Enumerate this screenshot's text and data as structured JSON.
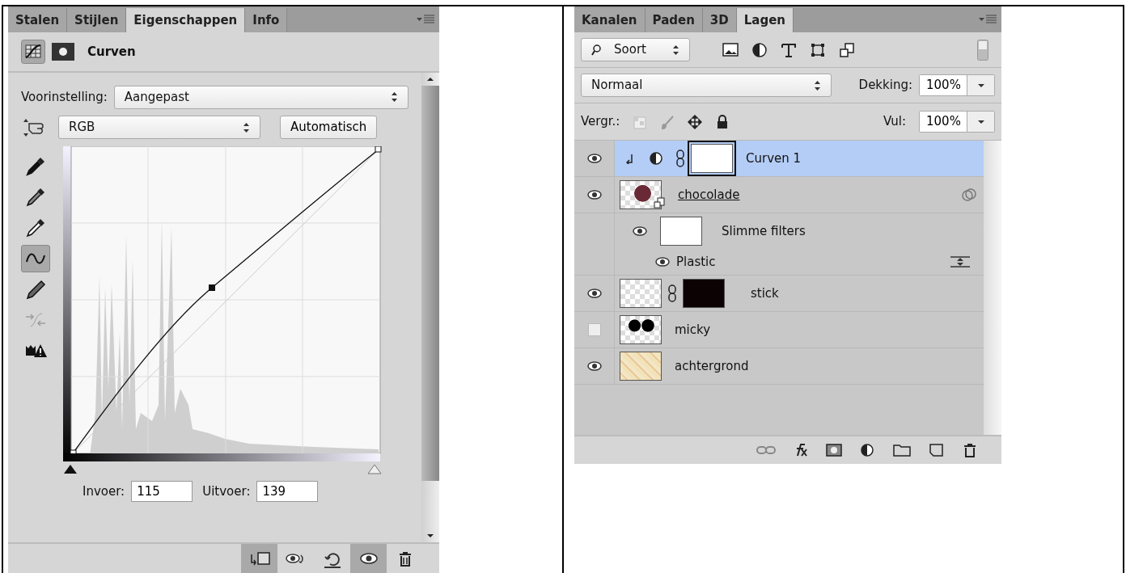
{
  "properties_panel": {
    "tabs": [
      {
        "label": "Stalen",
        "selected": false
      },
      {
        "label": "Stijlen",
        "selected": false
      },
      {
        "label": "Eigenschappen",
        "selected": true
      },
      {
        "label": "Info",
        "selected": false
      }
    ],
    "title": "Curven",
    "preset": {
      "label": "Voorinstelling:",
      "value": "Aangepast"
    },
    "channel": {
      "value": "RGB"
    },
    "auto_button": "Automatisch",
    "tools": [
      {
        "selected": false,
        "disabled": false
      },
      {
        "selected": false,
        "disabled": false
      },
      {
        "selected": false,
        "disabled": false
      },
      {
        "selected": true,
        "disabled": false
      },
      {
        "selected": false,
        "disabled": false
      },
      {
        "selected": false,
        "disabled": true
      },
      {
        "selected": false,
        "disabled": false
      }
    ],
    "input": {
      "label": "Invoer:",
      "value": "115"
    },
    "output": {
      "label": "Uitvoer:",
      "value": "139"
    },
    "footer_buttons": [
      {
        "pressed": true
      },
      {
        "pressed": false
      },
      {
        "pressed": false
      },
      {
        "pressed": true
      },
      {
        "pressed": false
      }
    ]
  },
  "layers_panel": {
    "tabs": [
      {
        "label": "Kanalen",
        "selected": false
      },
      {
        "label": "Paden",
        "selected": false
      },
      {
        "label": "3D",
        "selected": false
      },
      {
        "label": "Lagen",
        "selected": true
      }
    ],
    "filter": {
      "value": "Soort"
    },
    "blend_mode": {
      "value": "Normaal"
    },
    "opacity": {
      "label": "Dekking:",
      "value": "100%"
    },
    "lock": {
      "label": "Vergr.:"
    },
    "fill": {
      "label": "Vul:",
      "value": "100%"
    },
    "layers": [
      {
        "name": "Curven 1",
        "kind": "adjustment",
        "visible": true,
        "selected": true
      },
      {
        "name": "chocolade",
        "kind": "smart",
        "visible": true,
        "selected": false,
        "children": [
          {
            "name": "Slimme filters",
            "visible": true,
            "children": [
              {
                "name": "Plastic",
                "visible": true
              }
            ]
          }
        ]
      },
      {
        "name": "stick",
        "kind": "masked",
        "visible": true,
        "selected": false
      },
      {
        "name": "micky",
        "kind": "image",
        "visible": false,
        "selected": false
      },
      {
        "name": "achtergrond",
        "kind": "pattern",
        "visible": true,
        "selected": false
      }
    ]
  }
}
